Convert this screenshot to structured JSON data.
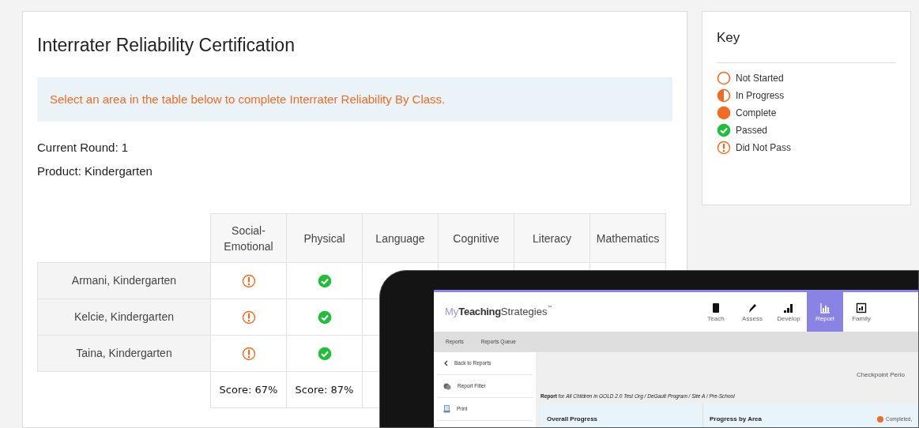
{
  "certification": {
    "title": "Interrater Reliability Certification",
    "notice": "Select an area in the table below to complete Interrater Reliability By Class.",
    "current_round": "Current Round: 1",
    "product": "Product: Kindergarten",
    "table": {
      "columns": [
        "Social-\nEmotional",
        "Physical",
        "Language",
        "Cognitive",
        "Literacy",
        "Mathematics"
      ],
      "rows": [
        {
          "name": "Armani, Kindergarten",
          "cells": [
            {
              "kind": "did_not_pass"
            },
            {
              "kind": "passed"
            }
          ]
        },
        {
          "name": "Kelcie, Kindergarten",
          "cells": [
            {
              "kind": "did_not_pass"
            },
            {
              "kind": "passed"
            }
          ]
        },
        {
          "name": "Taina, Kindergarten",
          "cells": [
            {
              "kind": "did_not_pass"
            },
            {
              "kind": "passed"
            }
          ]
        }
      ],
      "scores": [
        "Score: 67%",
        "Score: 87%"
      ]
    }
  },
  "key": {
    "title": "Key",
    "items": [
      {
        "kind": "not_started",
        "label": "Not Started"
      },
      {
        "kind": "in_progress",
        "label": "In Progress"
      },
      {
        "kind": "complete",
        "label": "Complete"
      },
      {
        "kind": "passed",
        "label": "Passed"
      },
      {
        "kind": "did_not_pass",
        "label": "Did Not Pass"
      }
    ]
  },
  "tablet": {
    "logo": [
      "My",
      "Teaching",
      "Strategies",
      "™"
    ],
    "nav": [
      {
        "label": "Teach",
        "selected": false
      },
      {
        "label": "Assess",
        "selected": false
      },
      {
        "label": "Develop",
        "selected": false
      },
      {
        "label": "Report",
        "selected": true
      },
      {
        "label": "Family",
        "selected": false
      }
    ],
    "subnav": [
      "Reports",
      "Reports Queue"
    ],
    "sidebar": [
      {
        "label": "Back to Reports"
      },
      {
        "label": "Report Filter"
      },
      {
        "label": "Print"
      }
    ],
    "checkpoint": "Checkpoint Perio",
    "report_line": "**Report** for *All Children in GOLD 2.0 Test Org / DeGault Program / Site A / Pre-School*",
    "table_headers": [
      "Overall Progress",
      "Progress by Area"
    ],
    "legend": "Completed,"
  }
}
